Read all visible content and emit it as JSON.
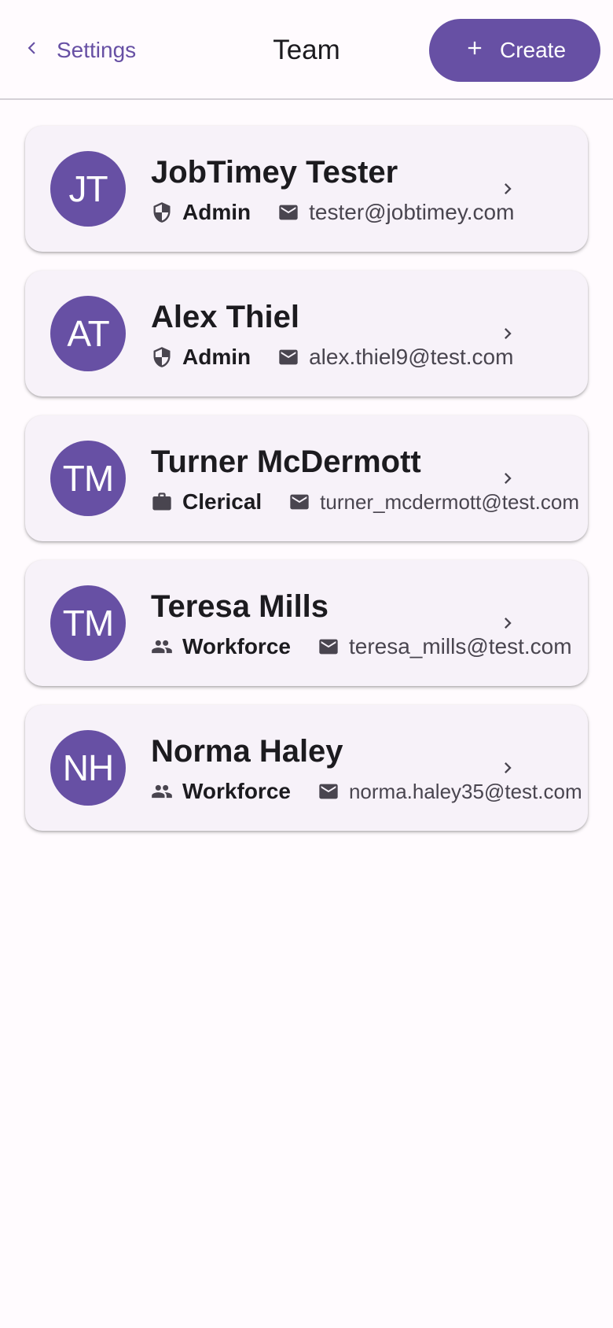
{
  "header": {
    "back_label": "Settings",
    "title": "Team",
    "create_label": "Create"
  },
  "colors": {
    "primary": "#6750a4",
    "card_background": "#f7f2f9",
    "page_background": "#fffbfe"
  },
  "members": [
    {
      "initials": "JT",
      "name": "JobTimey Tester",
      "role": "Admin",
      "role_icon": "shield-icon",
      "email": "tester@jobtimey.com"
    },
    {
      "initials": "AT",
      "name": "Alex Thiel",
      "role": "Admin",
      "role_icon": "shield-icon",
      "email": "alex.thiel9@test.com"
    },
    {
      "initials": "TM",
      "name": "Turner McDermott",
      "role": "Clerical",
      "role_icon": "briefcase-icon",
      "email": "turner_mcdermott@test.com"
    },
    {
      "initials": "TM",
      "name": "Teresa Mills",
      "role": "Workforce",
      "role_icon": "group-icon",
      "email": "teresa_mills@test.com"
    },
    {
      "initials": "NH",
      "name": "Norma Haley",
      "role": "Workforce",
      "role_icon": "group-icon",
      "email": "norma.haley35@test.com"
    }
  ]
}
